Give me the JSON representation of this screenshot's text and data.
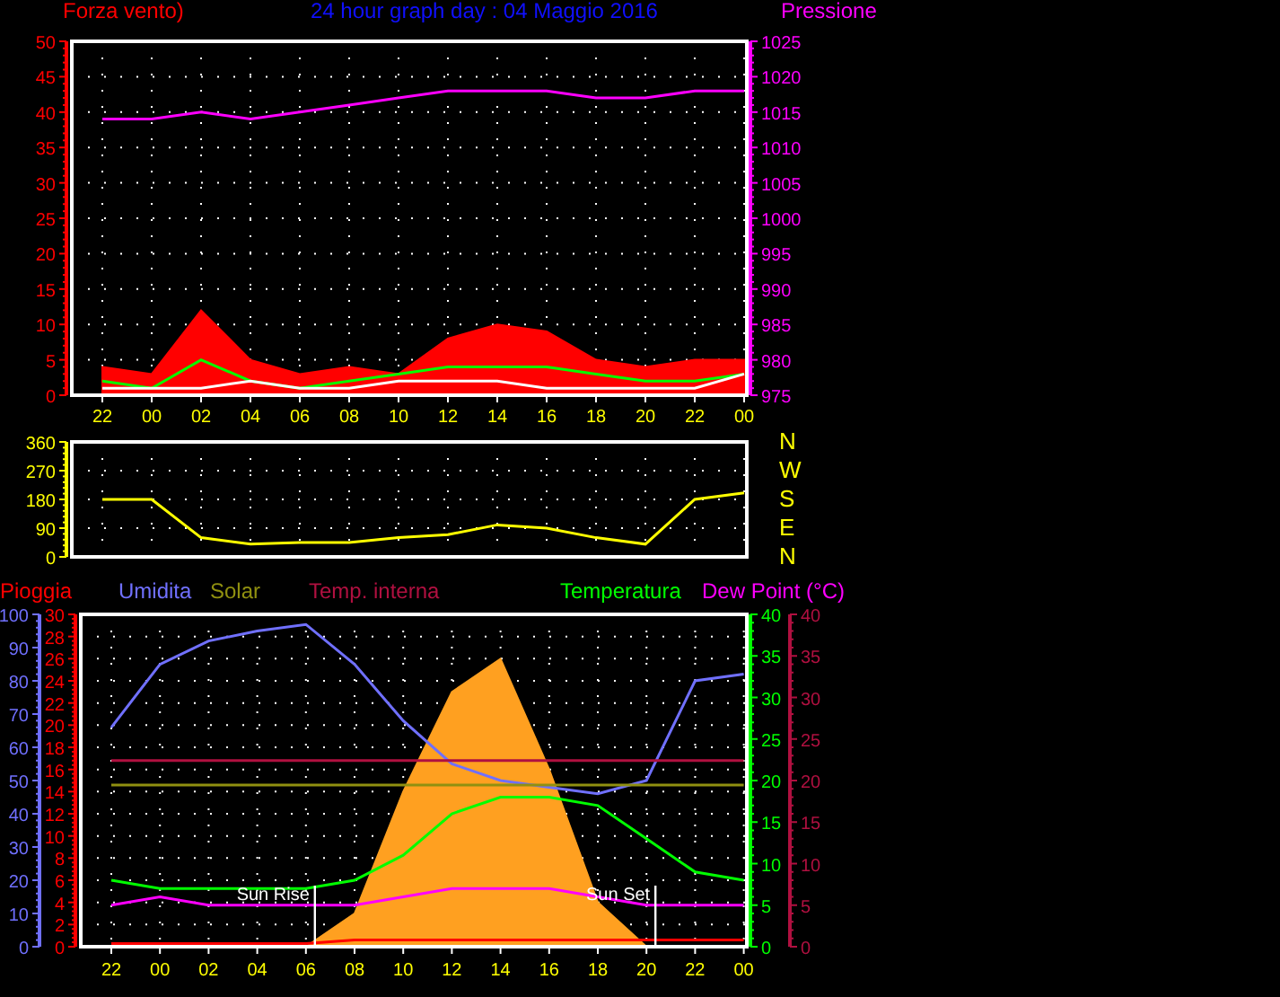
{
  "panels": [
    {
      "chart_data": {
        "type": "line",
        "grid": true,
        "title": "24 hour graph day : 04 Maggio 2016",
        "categories": [
          "22",
          "00",
          "02",
          "04",
          "06",
          "08",
          "10",
          "12",
          "14",
          "16",
          "18",
          "20",
          "22",
          "00"
        ],
        "ylim": [
          0,
          50
        ],
        "yticks": [
          0,
          5,
          10,
          15,
          20,
          25,
          30,
          35,
          40,
          45,
          50
        ],
        "y2lim": [
          975,
          1025
        ],
        "y2ticks": [
          975,
          980,
          985,
          990,
          995,
          1000,
          1005,
          1010,
          1015,
          1020,
          1025
        ],
        "series": [
          {
            "name": "Forza vento)",
            "color": "#ff0000",
            "type": "area",
            "values": [
              4,
              3,
              12,
              5,
              3,
              4,
              3,
              8,
              10,
              9,
              5,
              4,
              5,
              5
            ]
          },
          {
            "color": "#00ff00",
            "values": [
              2,
              1,
              5,
              2,
              1,
              2,
              3,
              4,
              4,
              4,
              3,
              2,
              2,
              3
            ]
          },
          {
            "color": "#ffffff",
            "values": [
              1,
              1,
              1,
              2,
              1,
              1,
              2,
              2,
              2,
              1,
              1,
              1,
              1,
              3
            ]
          },
          {
            "name": "Pressione",
            "color": "#ff00ff",
            "axis": "y2",
            "values": [
              1014,
              1014,
              1015,
              1014,
              1015,
              1016,
              1017,
              1018,
              1018,
              1018,
              1017,
              1017,
              1018,
              1018
            ]
          }
        ]
      }
    },
    {
      "direction_labels": [
        "N",
        "W",
        "S",
        "E",
        "N"
      ],
      "chart_data": {
        "type": "line",
        "grid": true,
        "ylim": [
          0,
          360
        ],
        "yticks": [
          0,
          90,
          180,
          270,
          360
        ],
        "series": [
          {
            "color": "#ffff00",
            "values": [
              180,
              180,
              60,
              40,
              45,
              45,
              60,
              70,
              100,
              90,
              60,
              40,
              180,
              200
            ]
          }
        ]
      }
    },
    {
      "right_axis_2": {
        "ticks": [
          "40",
          "35",
          "30",
          "25",
          "20",
          "15",
          "10",
          "5",
          "0"
        ]
      },
      "chart_data": {
        "type": "line",
        "grid": true,
        "categories": [
          "22",
          "00",
          "02",
          "04",
          "06",
          "08",
          "10",
          "12",
          "14",
          "16",
          "18",
          "20",
          "22",
          "00"
        ],
        "ylim": [
          0,
          30
        ],
        "yticks": [
          0,
          2,
          4,
          6,
          8,
          10,
          12,
          14,
          16,
          18,
          20,
          22,
          24,
          26,
          28,
          30
        ],
        "y2lim": [
          0,
          40
        ],
        "y2ticks": [
          0,
          5,
          10,
          15,
          20,
          25,
          30,
          35,
          40
        ],
        "y3lim": [
          0,
          100
        ],
        "y3ticks": [
          0,
          10,
          20,
          30,
          40,
          50,
          60,
          70,
          80,
          90,
          100
        ],
        "series": [
          {
            "color": "#ffa020",
            "type": "area",
            "values": [
              0,
              0,
              0,
              0,
              0,
              3,
              14,
              23,
              26,
              16,
              4,
              0,
              0,
              0
            ]
          },
          {
            "name": "Pioggia",
            "color": "#ff0000",
            "values": [
              0.3,
              0.3,
              0.3,
              0.3,
              0.3,
              0.6,
              0.6,
              0.6,
              0.6,
              0.6,
              0.6,
              0.6,
              0.6,
              0.6
            ]
          },
          {
            "name": "Umidita",
            "color": "#7070ff",
            "axis": "y3",
            "values": [
              66,
              85,
              92,
              95,
              97,
              85,
              68,
              55,
              50,
              48,
              46,
              50,
              80,
              82
            ]
          },
          {
            "name": "Solar",
            "color": "#909010",
            "values": [
              14.6,
              14.6,
              14.6,
              14.6,
              14.6,
              14.6,
              14.6,
              14.6,
              14.6,
              14.6,
              14.6,
              14.6,
              14.6,
              14.6
            ]
          },
          {
            "name": "Temp. interna",
            "color": "#b01040",
            "values": [
              16.8,
              16.8,
              16.8,
              16.8,
              16.8,
              16.8,
              16.8,
              16.8,
              16.8,
              16.8,
              16.8,
              16.8,
              16.8,
              16.8
            ]
          },
          {
            "name": "Temperatura",
            "color": "#00ff00",
            "axis": "y2",
            "values": [
              8,
              7,
              7,
              7,
              7,
              8,
              11,
              16,
              18,
              18,
              17,
              13,
              9,
              8
            ]
          },
          {
            "name": "Dew Point (°C)",
            "color": "#ff00ff",
            "axis": "y2",
            "values": [
              5,
              6,
              5,
              5,
              5,
              5,
              6,
              7,
              7,
              7,
              6,
              5,
              5,
              5
            ]
          }
        ],
        "annotations": [
          {
            "text": "Sun Rise",
            "x": "06"
          },
          {
            "text": "Sun Set",
            "x": "20"
          }
        ]
      }
    }
  ]
}
